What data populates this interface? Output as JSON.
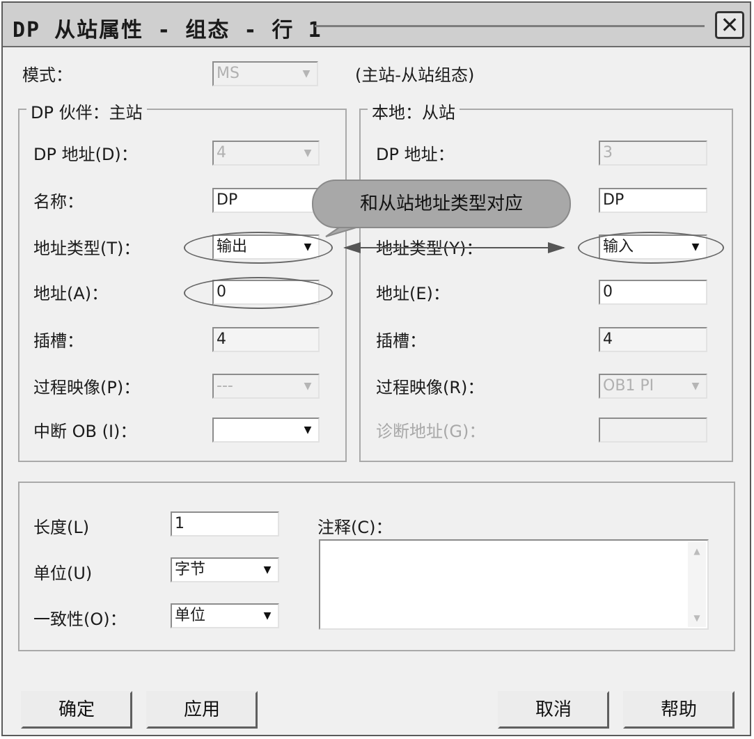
{
  "window": {
    "title": "DP 从站属性 - 组态 - 行 1"
  },
  "mode": {
    "label": "模式：",
    "value": "MS",
    "description": "(主站-从站组态)"
  },
  "partner": {
    "group_title": "DP 伙伴：主站",
    "dp_address_label": "DP 地址(D)：",
    "dp_address_value": "4",
    "name_label": "名称：",
    "name_value": "DP",
    "address_type_label": "地址类型(T)：",
    "address_type_value": "输出",
    "address_label": "地址(A)：",
    "address_value": "0",
    "slot_label": "插槽：",
    "slot_value": "4",
    "process_image_label": "过程映像(P)：",
    "process_image_value": "---",
    "interrupt_ob_label": "中断 OB (I)：",
    "interrupt_ob_value": ""
  },
  "local": {
    "group_title": "本地：从站",
    "dp_address_label": "DP 地址：",
    "dp_address_value": "3",
    "name_value": "DP",
    "address_type_label": "地址类型(Y)：",
    "address_type_value": "输入",
    "address_label": "地址(E)：",
    "address_value": "0",
    "slot_label": "插槽：",
    "slot_value": "4",
    "process_image_label": "过程映像(R)：",
    "process_image_value": "OB1 PI",
    "diag_address_label": "诊断地址(G)：",
    "diag_address_value": ""
  },
  "annotation": {
    "callout_text": "和从站地址类型对应"
  },
  "bottom": {
    "length_label": "长度(L)",
    "length_value": "1",
    "unit_label": "单位(U)",
    "unit_value": "字节",
    "consistency_label": "一致性(O)：",
    "consistency_value": "单位",
    "comment_label": "注释(C)：",
    "comment_value": ""
  },
  "buttons": {
    "ok": "确定",
    "apply": "应用",
    "cancel": "取消",
    "help": "帮助"
  },
  "icons": {
    "close": "close-icon",
    "dropdown": "chevron-down-icon",
    "scroll_up": "scroll-up-icon",
    "scroll_down": "scroll-down-icon"
  }
}
